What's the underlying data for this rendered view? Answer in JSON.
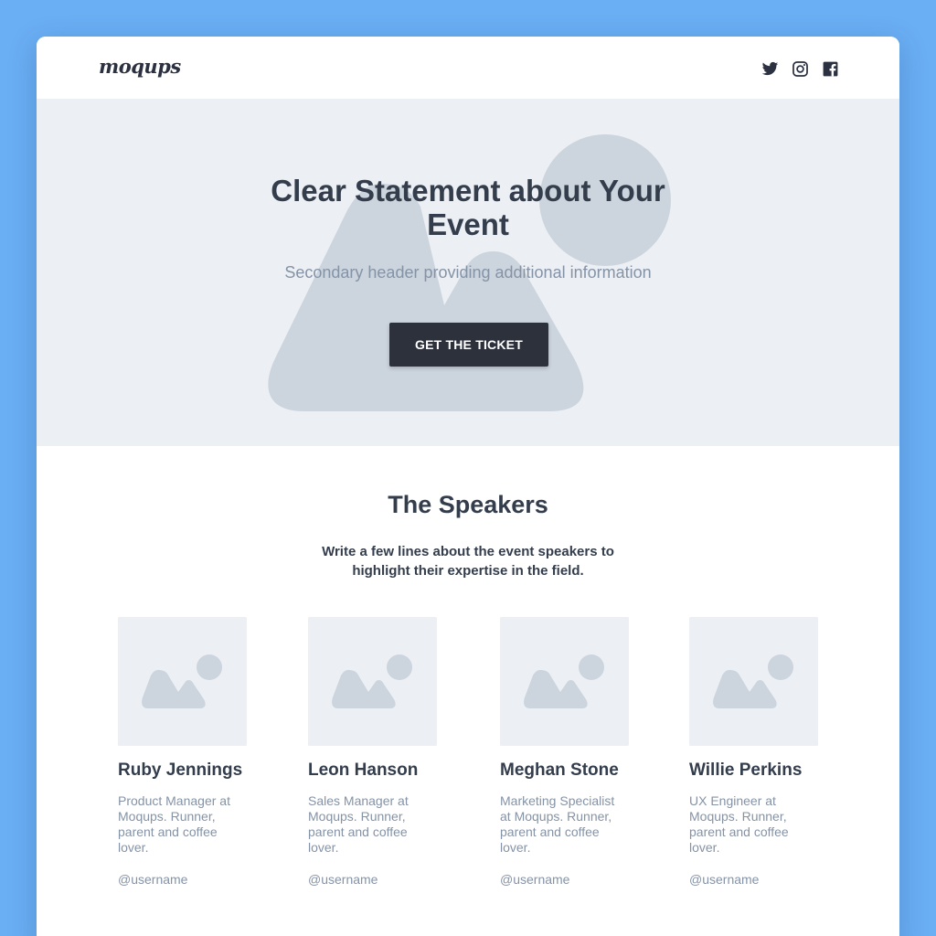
{
  "header": {
    "logo": "moqups",
    "social": [
      {
        "icon": "twitter-icon"
      },
      {
        "icon": "instagram-icon"
      },
      {
        "icon": "facebook-icon"
      }
    ]
  },
  "hero": {
    "title": "Clear Statement about Your Event",
    "subtitle": "Secondary header providing additional information",
    "cta_label": "GET THE TICKET"
  },
  "speakers_section": {
    "title": "The Speakers",
    "description": "Write a few lines about the event speakers to highlight their expertise in the field.",
    "speakers": [
      {
        "name": "Ruby Jennings",
        "role": "Product Manager at Moqups. Runner, parent and coffee lover.",
        "handle": "@username"
      },
      {
        "name": "Leon Hanson",
        "role": "Sales Manager at Moqups.  Runner, parent and coffee lover.",
        "handle": "@username"
      },
      {
        "name": "Meghan Stone",
        "role": "Marketing Specialist at Moqups. Runner, parent and coffee lover.",
        "handle": "@username"
      },
      {
        "name": "Willie Perkins",
        "role": "UX Engineer at Moqups. Runner, parent and coffee lover.",
        "handle": "@username"
      }
    ]
  },
  "colors": {
    "page_background": "#6aaef3",
    "hero_background": "#eceff3",
    "placeholder_shape": "#ccd4de",
    "heading_text": "#333d4c",
    "muted_text": "#8593a6",
    "button": "#2c313c"
  }
}
